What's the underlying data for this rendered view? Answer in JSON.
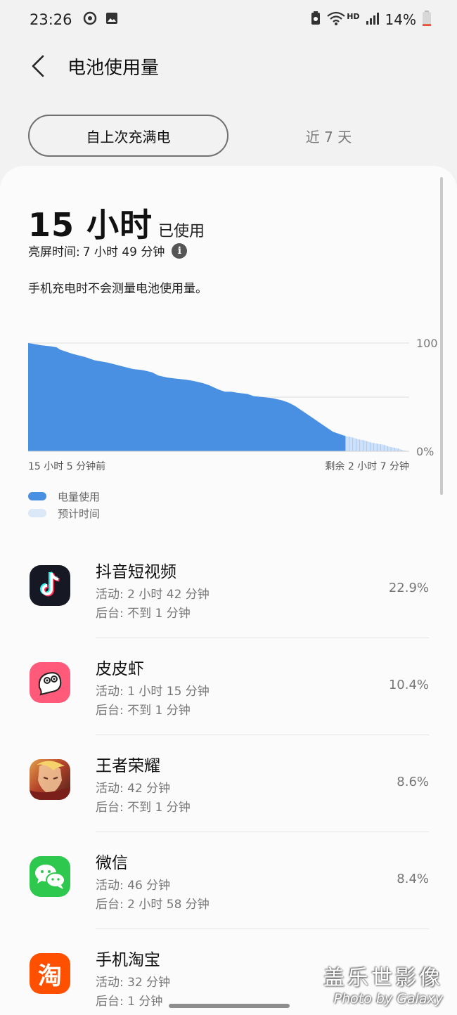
{
  "status_bar": {
    "time": "23:26",
    "network_label": "HD",
    "battery_percent": "14%",
    "icons": [
      "notification-badge-icon",
      "gallery-icon",
      "battery-saver-icon",
      "wifi-icon",
      "signal-icon",
      "battery-icon"
    ],
    "battery_level": 0.14,
    "battery_low_color": "#e5533b"
  },
  "header": {
    "title": "电池使用量"
  },
  "tabs": [
    {
      "label": "自上次充满电",
      "active": true
    },
    {
      "label": "近 7 天",
      "active": false
    }
  ],
  "summary": {
    "used_value": "15 小时",
    "used_suffix": "已使用",
    "screen_time_label": "亮屏时间:",
    "screen_time_value": "7 小时 49 分钟",
    "note": "手机充电时不会测量电池使用量。"
  },
  "chart_data": {
    "type": "area",
    "y_ticks": [
      "100",
      "0%"
    ],
    "ylim": [
      0,
      100
    ],
    "x_start_label": "15 小时 5 分钟前",
    "x_end_label": "剩余 2 小时 7 分钟",
    "grid": true,
    "series": [
      {
        "name": "电量使用",
        "color": "#4a90e2",
        "x": [
          0,
          2,
          4,
          7,
          9,
          10,
          12,
          14,
          18,
          21,
          25,
          29,
          33,
          36,
          39,
          41,
          44,
          47,
          50,
          52,
          55,
          57,
          60,
          62,
          64,
          66,
          69,
          71,
          74,
          77,
          80,
          82,
          84,
          86,
          88,
          90,
          92,
          94,
          96,
          98,
          100
        ],
        "values": [
          100,
          99,
          98,
          97,
          96,
          94,
          92,
          90,
          87,
          84,
          82,
          79,
          76,
          75,
          73,
          70,
          68,
          67,
          66,
          65,
          63,
          61,
          57,
          55,
          55,
          54,
          53,
          51,
          50,
          49,
          47,
          45,
          42,
          38,
          34,
          30,
          26,
          22,
          18,
          16,
          14
        ]
      },
      {
        "name": "预计时间",
        "color": "#cfe1f8",
        "x": [
          100,
          102,
          104,
          106,
          108,
          110,
          112,
          114,
          116,
          118,
          120
        ],
        "values": [
          14,
          13,
          11,
          10,
          8,
          7,
          6,
          4,
          3,
          1,
          0
        ]
      }
    ]
  },
  "legend": [
    {
      "label": "电量使用",
      "color": "#4a90e2"
    },
    {
      "label": "预计时间",
      "color": "#dbe8f8"
    }
  ],
  "apps": [
    {
      "name": "抖音短视频",
      "active": "活动: 2 小时 42 分钟",
      "background": "后台: 不到 1 分钟",
      "percent": "22.9%",
      "icon": "douyin-icon"
    },
    {
      "name": "皮皮虾",
      "active": "活动: 1 小时 15 分钟",
      "background": "后台: 不到 1 分钟",
      "percent": "10.4%",
      "icon": "pipixia-icon"
    },
    {
      "name": "王者荣耀",
      "active": "活动: 42 分钟",
      "background": "后台: 不到 1 分钟",
      "percent": "8.6%",
      "icon": "honor-of-kings-icon"
    },
    {
      "name": "微信",
      "active": "活动: 46 分钟",
      "background": "后台: 2 小时 58 分钟",
      "percent": "8.4%",
      "icon": "wechat-icon"
    },
    {
      "name": "手机淘宝",
      "active": "活动: 32 分钟",
      "background": "后台: 1 分钟",
      "percent": "",
      "icon": "taobao-icon"
    }
  ],
  "taobao_glyph": "淘",
  "watermark": {
    "line1": "盖乐世影像",
    "line2": "Photo by Galaxy"
  }
}
